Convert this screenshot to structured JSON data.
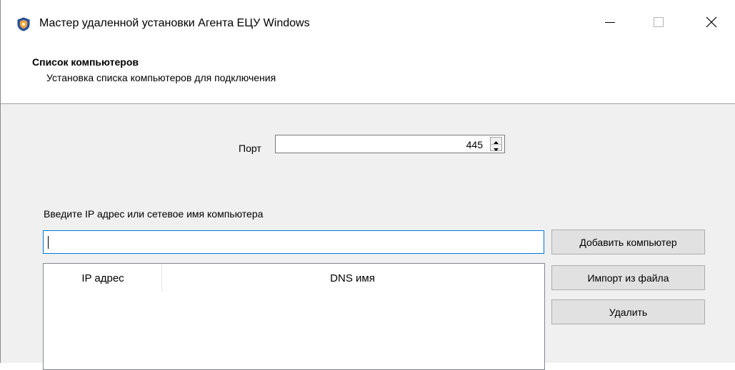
{
  "window": {
    "title": "Мастер удаленной установки Агента ЕЦУ Windows",
    "icon": "shield-icon",
    "controls": {
      "minimize": "minimize-icon",
      "maximize": "maximize-icon",
      "close": "close-icon"
    }
  },
  "header": {
    "title": "Список компьютеров",
    "subtitle": "Установка списка компьютеров для подключения"
  },
  "port": {
    "label": "Порт",
    "value": "445"
  },
  "address": {
    "label": "Введите IP адрес или сетевое имя компьютера",
    "value": ""
  },
  "buttons": {
    "add": "Добавить компьютер",
    "import": "Импорт из файла",
    "delete": "Удалить"
  },
  "table": {
    "columns": [
      "IP адрес",
      "DNS имя"
    ],
    "rows": []
  },
  "colors": {
    "focus_border": "#0078d7",
    "button_bg": "#e1e1e1",
    "dialog_bg": "#f0f0f0"
  }
}
